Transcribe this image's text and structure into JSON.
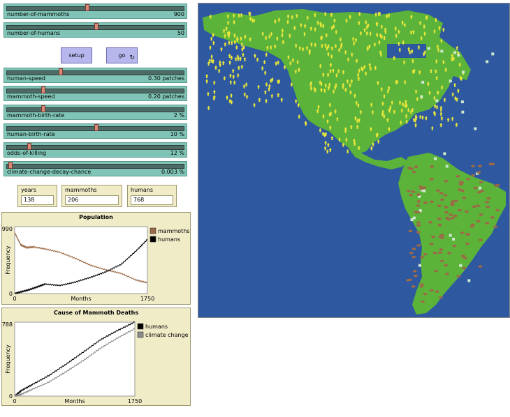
{
  "sliders": [
    {
      "label": "number-of-mammoths",
      "value": "900",
      "fraction": 0.45
    },
    {
      "label": "number-of-humans",
      "value": "50",
      "fraction": 0.5
    },
    {
      "label": "human-speed",
      "value": "0.30 patches",
      "fraction": 0.3
    },
    {
      "label": "mammoth-speed",
      "value": "0.20 patches",
      "fraction": 0.2
    },
    {
      "label": "mammoth-birth-rate",
      "value": "2 %",
      "fraction": 0.2
    },
    {
      "label": "human-birth-rate",
      "value": "10 %",
      "fraction": 0.5
    },
    {
      "label": "odds-of-killing",
      "value": "12 %",
      "fraction": 0.12
    },
    {
      "label": "climate-change-decay-chance",
      "value": "0.003 %",
      "fraction": 0.01
    }
  ],
  "buttons": {
    "setup": "setup",
    "go": "go",
    "go_icon": "forever-loop-icon"
  },
  "monitors": [
    {
      "label": "years",
      "value": "138"
    },
    {
      "label": "mammoths",
      "value": "206"
    },
    {
      "label": "humans",
      "value": "768"
    }
  ],
  "colors": {
    "mammoths": "#9c6a46",
    "humans": "#000000",
    "climate": "#8a8a8a",
    "ocean": "#2e58a0",
    "land": "#5cb33a",
    "people": "#e8e63a"
  },
  "chart_data": [
    {
      "type": "line",
      "title": "Population",
      "xlabel": "Months",
      "ylabel": "Frequency",
      "xlim": [
        0,
        1750
      ],
      "ylim": [
        0,
        990
      ],
      "x_ticks": [
        "0",
        "1750"
      ],
      "y_ticks": [
        "0",
        "990"
      ],
      "legend": "top-right",
      "series": [
        {
          "name": "mammoths",
          "color": "#9c6a46",
          "x": [
            0,
            80,
            160,
            250,
            400,
            600,
            800,
            1000,
            1200,
            1400,
            1600,
            1750
          ],
          "y": [
            900,
            720,
            680,
            690,
            660,
            610,
            520,
            420,
            350,
            300,
            200,
            160
          ]
        },
        {
          "name": "humans",
          "color": "#000000",
          "x": [
            0,
            100,
            200,
            300,
            400,
            600,
            800,
            1000,
            1200,
            1400,
            1600,
            1750
          ],
          "y": [
            0,
            30,
            60,
            100,
            140,
            120,
            170,
            240,
            320,
            430,
            630,
            800
          ]
        }
      ]
    },
    {
      "type": "line",
      "title": "Cause of Mammoth Deaths",
      "xlabel": "Months",
      "ylabel": "Frequency",
      "xlim": [
        0,
        1750
      ],
      "ylim": [
        0,
        788
      ],
      "x_ticks": [
        "0",
        "1750"
      ],
      "y_ticks": [
        "0",
        "788"
      ],
      "legend": "top-right",
      "series": [
        {
          "name": "humans",
          "color": "#000000",
          "x": [
            0,
            100,
            250,
            500,
            750,
            1000,
            1250,
            1500,
            1750
          ],
          "y": [
            0,
            60,
            120,
            220,
            340,
            470,
            600,
            700,
            790
          ]
        },
        {
          "name": "climate change",
          "color": "#8a8a8a",
          "x": [
            0,
            100,
            250,
            500,
            750,
            1000,
            1250,
            1500,
            1750
          ],
          "y": [
            0,
            20,
            70,
            150,
            260,
            380,
            510,
            620,
            720
          ]
        }
      ]
    }
  ]
}
